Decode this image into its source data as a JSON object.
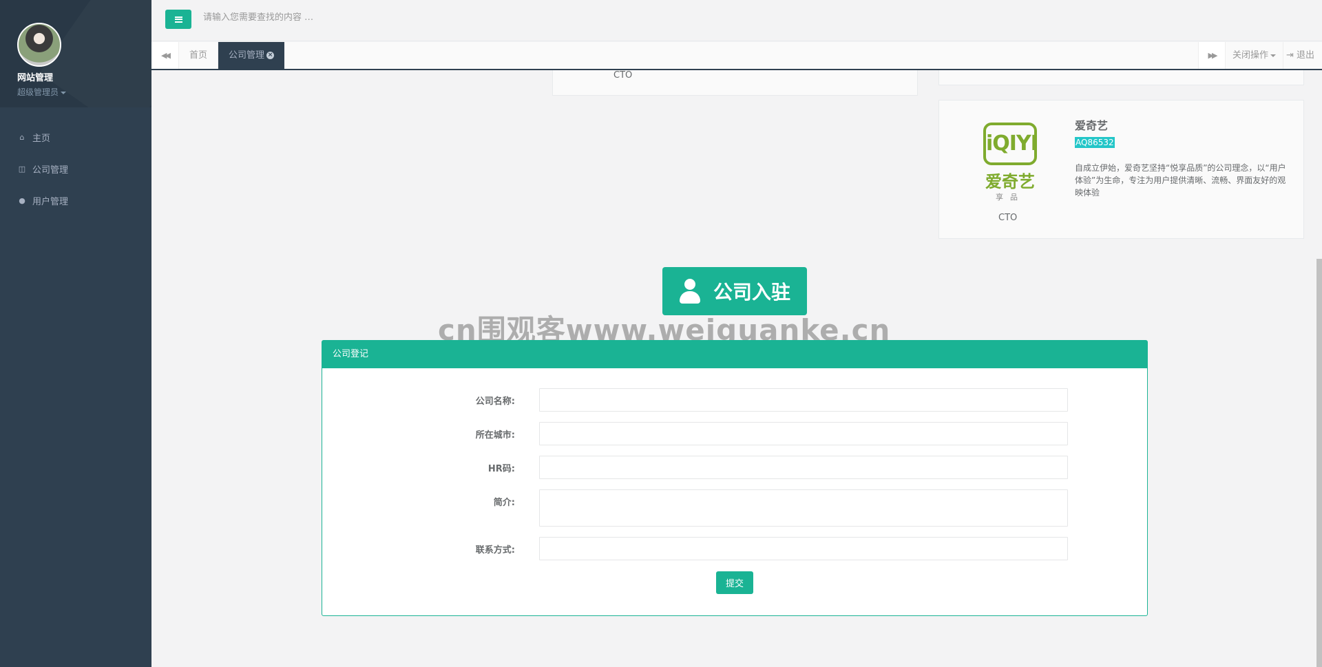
{
  "sidebar": {
    "profile_name": "网站管理",
    "profile_role": "超级管理员",
    "items": [
      {
        "icon": "home-icon",
        "label": "主页"
      },
      {
        "icon": "columns-icon",
        "label": "公司管理"
      },
      {
        "icon": "user-icon",
        "label": "用户管理"
      }
    ]
  },
  "topbar": {
    "search_placeholder": "请输入您需要查找的内容 …"
  },
  "tabs": {
    "home": "首页",
    "active": "公司管理",
    "close_ops": "关闭操作",
    "logout": "退出"
  },
  "content": {
    "partial_card_role": "CTO",
    "company": {
      "logo_text": "iQIYI",
      "logo_cn": "爱奇艺",
      "logo_sub": "享品",
      "role": "CTO",
      "name": "爱奇艺",
      "code": "AQ86532",
      "description": "自成立伊始，爱奇艺坚持“悦享品质”的公司理念，以“用户体验”为生命，专注为用户提供清晰、流畅、界面友好的观映体验"
    },
    "banner_title": "公司入驻",
    "watermark": "cn围观客www.weiguanke.cn"
  },
  "form": {
    "panel_title": "公司登记",
    "fields": [
      {
        "label": "公司名称:",
        "value": ""
      },
      {
        "label": "所在城市:",
        "value": ""
      },
      {
        "label": "HR码:",
        "value": ""
      },
      {
        "label": "简介:",
        "value": ""
      },
      {
        "label": "联系方式:",
        "value": ""
      }
    ],
    "submit_label": "提交"
  },
  "colors": {
    "accent": "#1ab394",
    "sidebar": "#2f4050",
    "code_badge": "#23c6c8",
    "iqiyi_green": "#7fab2e"
  }
}
